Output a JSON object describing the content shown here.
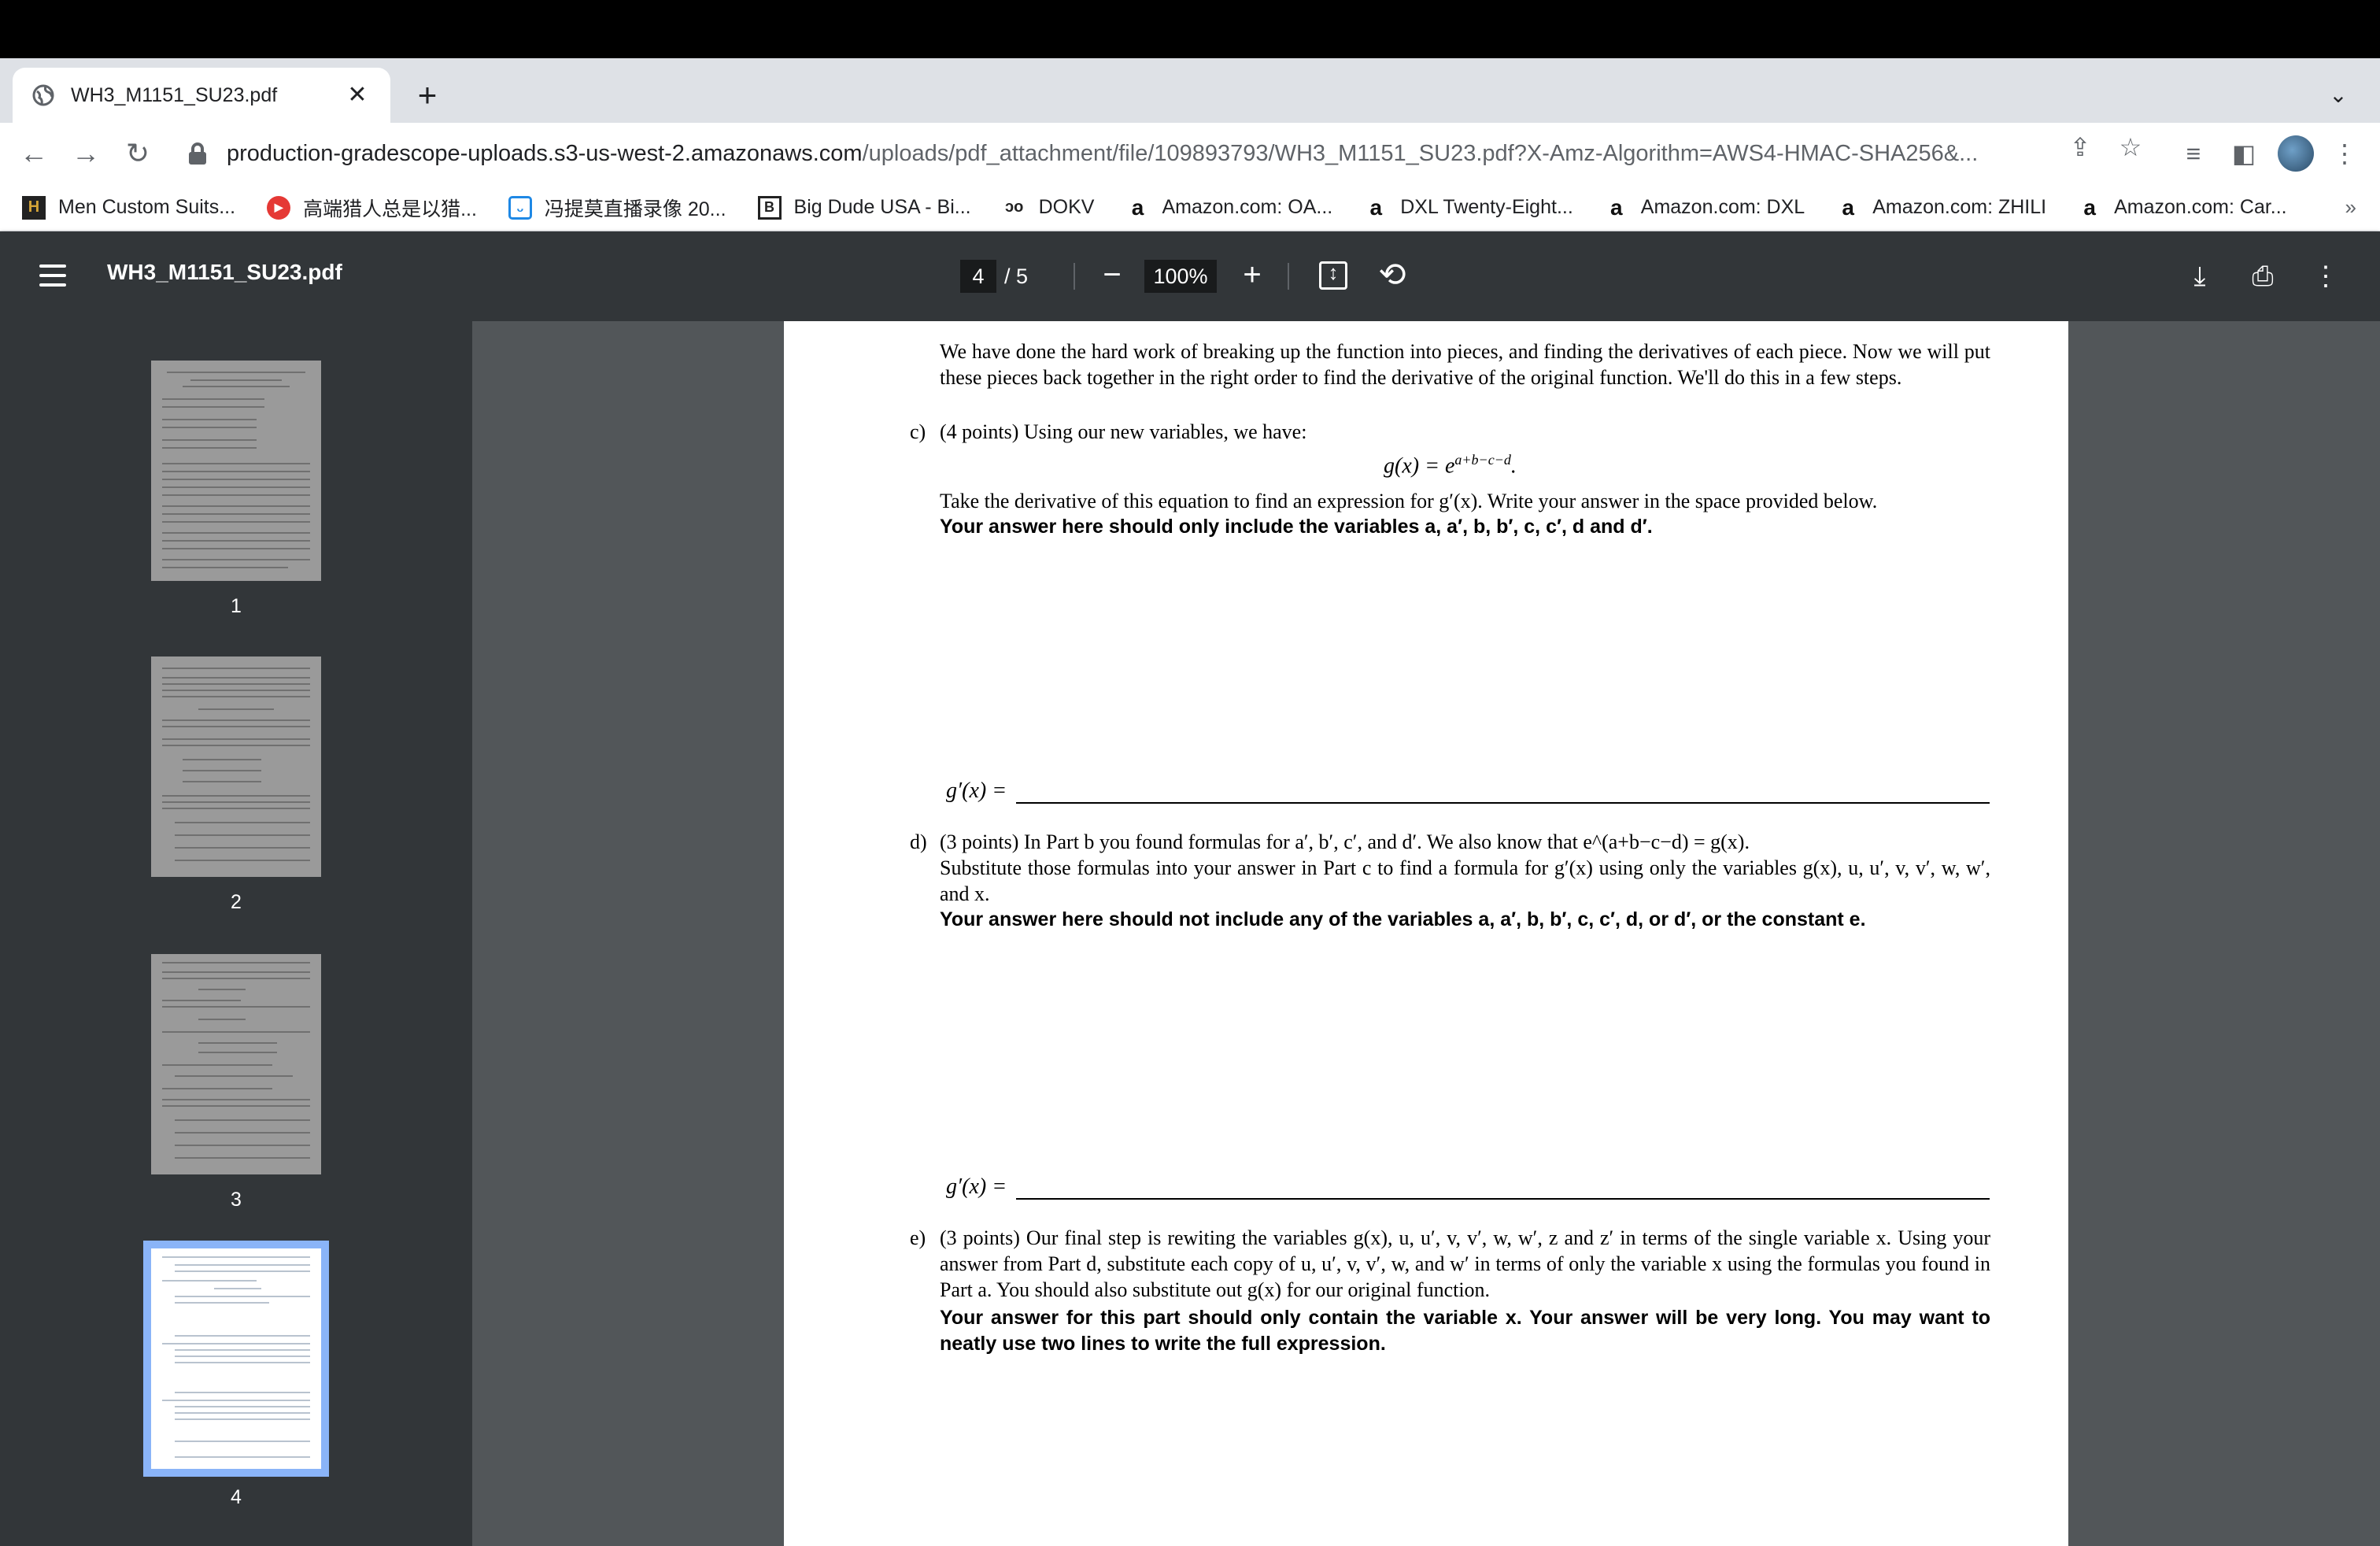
{
  "browser": {
    "tab": {
      "title": "WH3_M1151_SU23.pdf"
    },
    "url": {
      "host": "production-gradescope-uploads.s3-us-west-2.amazonaws.com",
      "path": "/uploads/pdf_attachment/file/109893793/WH3_M1151_SU23.pdf?X-Amz-Algorithm=AWS4-HMAC-SHA256&..."
    },
    "bookmarks": [
      {
        "label": "Men Custom Suits...",
        "icon": "h-icon"
      },
      {
        "label": "高端猎人总是以猎...",
        "icon": "red-play-icon"
      },
      {
        "label": "冯提莫直播录像 20...",
        "icon": "tv-icon"
      },
      {
        "label": "Big Dude USA - Bi...",
        "icon": "b-icon"
      },
      {
        "label": "DOKV",
        "icon": "dokv-icon"
      },
      {
        "label": "Amazon.com: OA...",
        "icon": "amazon-icon"
      },
      {
        "label": "DXL Twenty-Eight...",
        "icon": "amazon-icon"
      },
      {
        "label": "Amazon.com: DXL",
        "icon": "amazon-icon"
      },
      {
        "label": "Amazon.com: ZHILI",
        "icon": "amazon-icon"
      },
      {
        "label": "Amazon.com: Car...",
        "icon": "amazon-icon"
      }
    ],
    "bookmarks_overflow": "»"
  },
  "pdf_viewer": {
    "title": "WH3_M1151_SU23.pdf",
    "current_page": "4",
    "total_pages": "/  5",
    "zoom": "100%",
    "thumbnails": [
      {
        "label": "1",
        "active": false
      },
      {
        "label": "2",
        "active": false
      },
      {
        "label": "3",
        "active": false
      },
      {
        "label": "4",
        "active": true
      }
    ]
  },
  "page": {
    "intro": "We have done the hard work of breaking up the function into pieces, and finding the derivatives of each piece. Now we will put these pieces back together in the right order to find the derivative of the original function. We'll do this in a few steps.",
    "c_label": "c)",
    "c_text": "(4 points)  Using our new variables, we have:",
    "c_eq_lhs": "g(x) = e",
    "c_eq_exp": "a+b−c−d",
    "c_eq_end": ".",
    "c_instr": "Take the derivative of this equation to find an expression for g′(x). Write your answer in the space provided below.",
    "c_bold": "Your answer here should only include the variables a, a′, b, b′, c, c′, d and d′.",
    "answer_label": "g′(x) =",
    "d_label": "d)",
    "d_text": "(3 points)  In Part b you found formulas for a′, b′, c′, and d′. We also know that e^(a+b−c−d) = g(x).",
    "d_instr": "Substitute those formulas into your answer in Part c to find a formula for g′(x) using only the variables g(x), u, u′, v, v′, w, w′, and x.",
    "d_bold": "Your answer here should not include any of the variables a, a′, b, b′, c, c′, d, or d′, or the constant e.",
    "e_label": "e)",
    "e_text": "(3 points)  Our final step is rewiting the variables g(x), u, u′, v, v′, w, w′, z and z′ in terms of the single variable x. Using your answer from Part d, substitute each copy of u, u′, v, v′, w, and w′ in terms of only the variable x using the formulas you found in Part a. You should also substitute out g(x) for our original function.",
    "e_bold": "Your answer for this part should only contain the variable x. Your answer will be very long. You may want to neatly use two lines to write the full expression."
  }
}
